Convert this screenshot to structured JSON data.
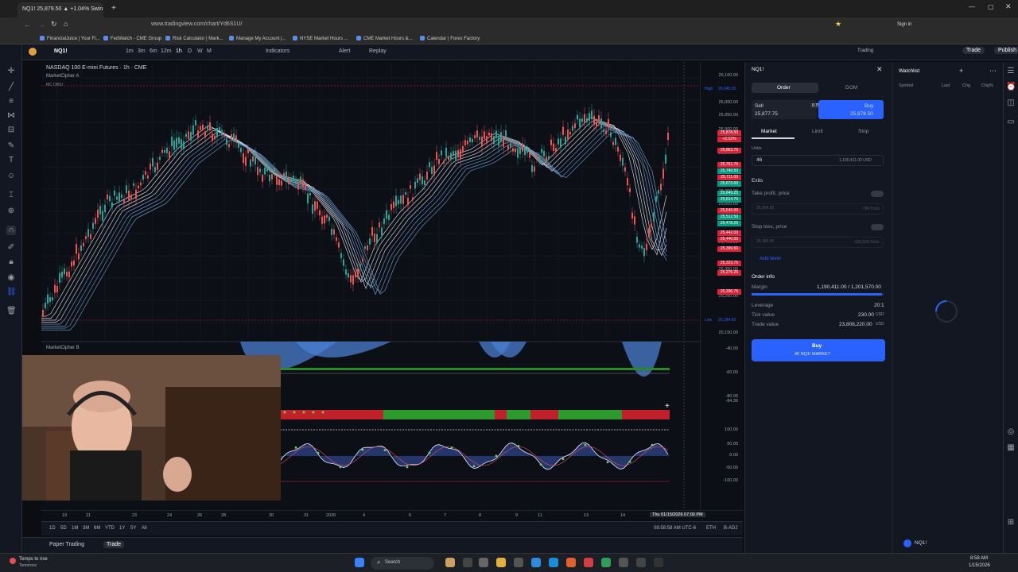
{
  "browser": {
    "tab_title": "NQ1! 25,879.50 ▲ +1.04% Swin",
    "url": "www.tradingview.com/chart/Yd6S1U/",
    "bookmarks": [
      "FinancialJuice | Your Fi...",
      "FedWatch - CME Group",
      "Risk Calculator | Mark...",
      "Manage My Account |...",
      "NYSE Market Hours ...",
      "CME Market Hours &...",
      "Calendar | Forex Factory"
    ],
    "sign_in": "Sign in"
  },
  "toolbar": {
    "symbol": "NQ1!",
    "intervals": [
      "1m",
      "3m",
      "6m",
      "12m",
      "1h",
      "D",
      "W",
      "M"
    ],
    "indicators": "Indicators",
    "alert": "Alert",
    "replay": "Replay",
    "trading": "Trading",
    "trade": "Trade",
    "publish": "Publish"
  },
  "chart": {
    "title": "NASDAQ 100 E-mini Futures · 1h · CME",
    "indicator_a": "MarketCipher A",
    "indicator_a_sub": "MC DBSI",
    "indicator_b": "MarketCipher B",
    "price_labels": [
      "26,100.00",
      "26,000.00",
      "25,950.00",
      "25,900.00",
      "25,800.00",
      "25,750.00",
      "25,650.00",
      "25,600.00",
      "25,550.00",
      "25,450.00",
      "25,350.00",
      "25,250.00",
      "25,150.00"
    ],
    "high_label": "High",
    "high_value": "26,045.50",
    "low_label": "Low",
    "low_value": "25,184.50",
    "price_tags": [
      {
        "v": "25,878.50",
        "c": "#d8243a"
      },
      {
        "v": "+2.02%",
        "c": "#d8243a"
      },
      {
        "v": "25,863.75",
        "c": "#d8243a"
      },
      {
        "v": "25,761.75",
        "c": "#d8243a"
      },
      {
        "v": "25,740.50",
        "c": "#089981"
      },
      {
        "v": "25,711.00",
        "c": "#d8243a"
      },
      {
        "v": "25,673.00",
        "c": "#089981"
      },
      {
        "v": "25,649.25",
        "c": "#089981"
      },
      {
        "v": "25,614.75",
        "c": "#089981"
      },
      {
        "v": "25,545.00",
        "c": "#d8243a"
      },
      {
        "v": "25,512.50",
        "c": "#089981"
      },
      {
        "v": "25,478.25",
        "c": "#089981"
      },
      {
        "v": "25,442.00",
        "c": "#d8243a"
      },
      {
        "v": "25,440.00",
        "c": "#d8243a"
      },
      {
        "v": "25,399.50",
        "c": "#d8243a"
      },
      {
        "v": "25,323.75",
        "c": "#d8243a"
      },
      {
        "v": "25,276.25",
        "c": "#d8243a"
      },
      {
        "v": "25,206.75",
        "c": "#d8243a"
      }
    ],
    "osc_labels": [
      "-40.00",
      "-60.00",
      "-80.00",
      "-84.39",
      "100.00",
      "50.00",
      "0.00",
      "-50.00",
      "-100.00"
    ],
    "time_labels": [
      "19",
      "21",
      "23",
      "24",
      "26",
      "28",
      "30",
      "31",
      "2026",
      "4",
      "6",
      "7",
      "8",
      "9",
      "11",
      "13",
      "14"
    ],
    "crosshair_time": "Thu 01/15/2026   07:00 PM",
    "ranges": [
      "1D",
      "5D",
      "1M",
      "3M",
      "6M",
      "YTD",
      "1Y",
      "5Y",
      "All"
    ],
    "clock": "08:58:58 AM UTC-6",
    "eth": "ETH",
    "badj": "B-ADJ"
  },
  "order_panel": {
    "symbol": "NQ1!",
    "tab_order": "Order",
    "tab_dom": "DOM",
    "sell_label": "Sell",
    "sell_price": "25,877.75",
    "spread": "0.75",
    "buy_label": "Buy",
    "buy_price": "25,878.50",
    "type_market": "Market",
    "type_limit": "Limit",
    "type_stop": "Stop",
    "units_label": "Units",
    "units_value": "46",
    "units_usd": "1,190,411.00 USD",
    "exits": "Exits",
    "take_profit": "Take profit, price",
    "tp_value": "25,904.50",
    "tp_ticks": "-794 Ticks",
    "stop_loss": "Stop loss, price",
    "sl_value": "25,360.50",
    "sl_ticks": "-150,599 Ticks",
    "add_level": "Add level",
    "order_info": "Order info",
    "margin_label": "Margin",
    "margin_value": "1,190,411.00 / 1,201,570.00",
    "margin_fill": 0.99,
    "leverage_label": "Leverage",
    "leverage_value": "20:1",
    "tick_label": "Tick value",
    "tick_value": "230.00",
    "tv_label": "Trade value",
    "tv_value": "23,808,220.00",
    "usd": "USD",
    "buy_btn": "Buy",
    "buy_btn_sub": "46 NQ1! MARKET"
  },
  "watchlist": {
    "title": "Watchlist",
    "cols": [
      "Symbol",
      "Last",
      "Chg",
      "Chg%"
    ],
    "footer_symbol": "NQ1!"
  },
  "bottom": {
    "paper": "Paper Trading",
    "trade": "Trade"
  },
  "taskbar": {
    "weather": "Temps to rise",
    "weather_sub": "Tomorrow",
    "search": "Search",
    "time": "8:58 AM",
    "date": "1/15/2026"
  }
}
